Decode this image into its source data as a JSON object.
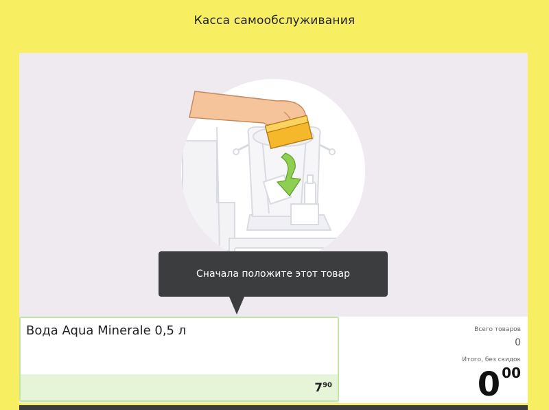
{
  "header": {
    "title": "Касса самообслуживания"
  },
  "instruction": {
    "tooltip": "Сначала положите этот товар"
  },
  "product": {
    "name": "Вода Aqua Minerale 0,5 л",
    "price_main": "7",
    "price_cents": "90"
  },
  "summary": {
    "items_label": "Всего товаров",
    "items_count": "0",
    "total_label": "Итого, без скидок",
    "total_main": "0",
    "total_cents": "00"
  },
  "colors": {
    "background": "#f7ef61",
    "panel": "#efeaf0",
    "tooltip": "#3c3d3f",
    "product_border": "#bfe6a4",
    "product_band": "#e6f5d8",
    "item_yellow": "#f4b82a",
    "arrow_green": "#8ecf52"
  },
  "illustration": {
    "icon": "place-item-in-bagging-area-icon"
  }
}
